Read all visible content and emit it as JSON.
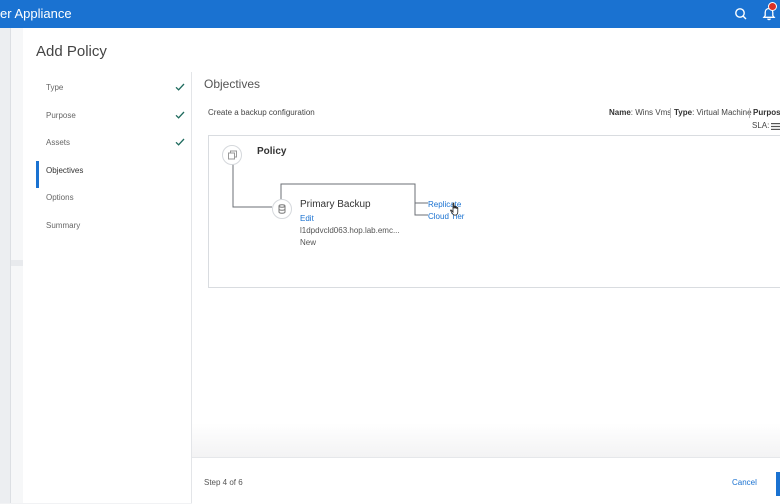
{
  "app": {
    "title": "er Appliance",
    "accent_color": "#1a72d1"
  },
  "topbar": {
    "search_icon": "search-icon",
    "notifications_icon": "bell-icon",
    "notifications_badge_color": "#d93025"
  },
  "dialog": {
    "title": "Add Policy",
    "steps": [
      {
        "label": "Type",
        "completed": true
      },
      {
        "label": "Purpose",
        "completed": true
      },
      {
        "label": "Assets",
        "completed": true
      },
      {
        "label": "Objectives",
        "completed": false,
        "active": true
      },
      {
        "label": "Options",
        "completed": false
      },
      {
        "label": "Summary",
        "completed": false
      }
    ],
    "section_title": "Objectives",
    "subtitle": "Create a backup configuration",
    "meta": {
      "name_label": "Name",
      "name_value": ": Wins Vms",
      "type_label": "Type",
      "type_value": ": Virtual Machine",
      "purpose_label": "Purpose",
      "sla_label": "SLA:"
    },
    "diagram": {
      "policy_label": "Policy",
      "primary_backup": {
        "title": "Primary Backup",
        "edit_label": "Edit",
        "target": "l1dpdvcld063.hop.lab.emc...",
        "status": "New"
      },
      "links": {
        "replicate": "Replicate",
        "cloud_tier": "Cloud Tier"
      }
    },
    "footer": {
      "step_text": "Step 4 of 6",
      "cancel_label": "Cancel"
    }
  }
}
